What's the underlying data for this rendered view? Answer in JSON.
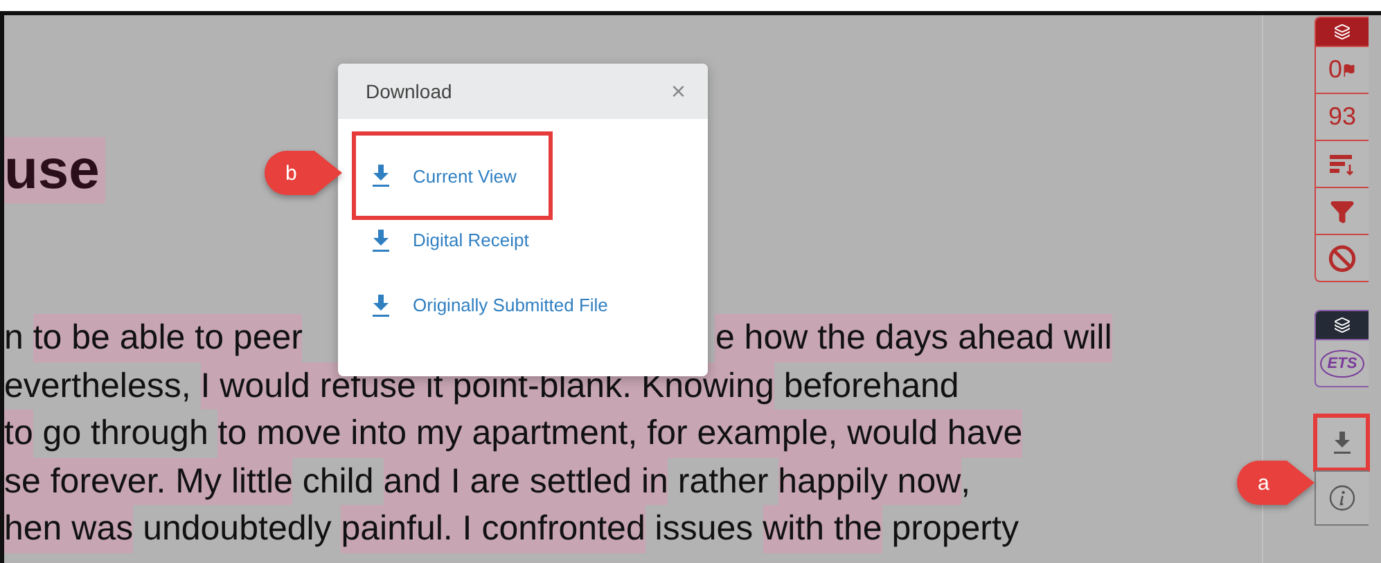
{
  "document": {
    "heading": {
      "text": "use",
      "highlighted": true
    },
    "lines": [
      {
        "parts": [
          [
            {
              "text": "n ",
              "highlighted": false
            },
            {
              "text": "to be able to peer",
              "highlighted": true
            }
          ],
          [
            {
              "text": "e how the days ahead will",
              "highlighted": true
            }
          ]
        ]
      },
      {
        "parts": [
          [
            {
              "text": "evertheless, ",
              "highlighted": false
            },
            {
              "text": "I would refuse it point-blank. Knowing",
              "highlighted": true
            },
            {
              "text": " beforehand",
              "highlighted": false
            }
          ]
        ]
      },
      {
        "parts": [
          [
            {
              "text": "to",
              "highlighted": true
            },
            {
              "text": " go through ",
              "highlighted": false
            },
            {
              "text": "to move into my apartment, for example, would have",
              "highlighted": true
            }
          ]
        ]
      },
      {
        "parts": [
          [
            {
              "text": "se forever. My little",
              "highlighted": true
            },
            {
              "text": " child ",
              "highlighted": false
            },
            {
              "text": "and I are settled in",
              "highlighted": true
            },
            {
              "text": " rather ",
              "highlighted": false
            },
            {
              "text": "happily now",
              "highlighted": true
            },
            {
              "text": ",",
              "highlighted": false
            }
          ]
        ]
      },
      {
        "parts": [
          [
            {
              "text": "hen was",
              "highlighted": true
            },
            {
              "text": " undoubtedly ",
              "highlighted": false
            },
            {
              "text": "painful. I confronted",
              "highlighted": true
            },
            {
              "text": " issues ",
              "highlighted": false
            },
            {
              "text": "with the",
              "highlighted": true
            },
            {
              "text": " property",
              "highlighted": false
            }
          ]
        ]
      }
    ]
  },
  "dialog": {
    "title": "Download",
    "close": "×",
    "items": [
      {
        "label": "Current View",
        "highlighted": true
      },
      {
        "label": "Digital Receipt",
        "highlighted": false
      },
      {
        "label": "Originally Submitted File",
        "highlighted": false
      }
    ]
  },
  "sidebar": {
    "groups": [
      {
        "kind": "similarity",
        "cells": [
          {
            "kind": "flags",
            "text": "0"
          },
          {
            "kind": "score",
            "text": "93"
          },
          {
            "kind": "sort"
          },
          {
            "kind": "filter"
          },
          {
            "kind": "exclude"
          }
        ]
      },
      {
        "kind": "ets",
        "cells": [
          {
            "kind": "ets",
            "text": "ETS"
          }
        ]
      }
    ],
    "buttons": [
      {
        "kind": "download",
        "highlighted": true
      },
      {
        "kind": "info",
        "highlighted": false
      }
    ]
  },
  "callouts": [
    {
      "text": "b"
    },
    {
      "text": "a"
    }
  ]
}
